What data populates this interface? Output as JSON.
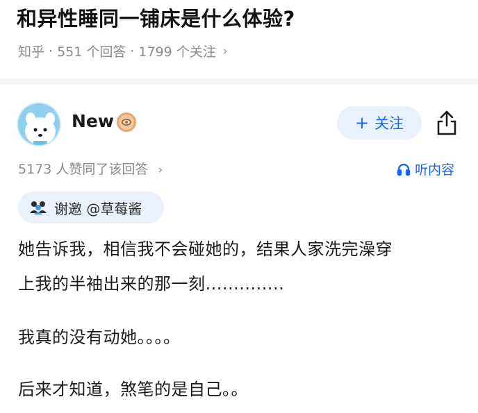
{
  "question": {
    "title": "和异性睡同一铺床是什么体验?",
    "meta": {
      "site": "知乎",
      "sep": "·",
      "answers": "551 个回答",
      "followers": "1799 个关注",
      "chevron": "›"
    }
  },
  "answer": {
    "author": {
      "name": "New",
      "avatar_icon": "cartoon-avatar-icon",
      "badge_icon": "eye-badge-icon"
    },
    "follow_button": {
      "plus": "+",
      "label": "关注"
    },
    "share_icon": "share-icon",
    "upvotes": {
      "text": "5173 人赞同了该回答",
      "chevron": "›"
    },
    "listen": {
      "icon": "headphones-icon",
      "label": "听内容"
    },
    "invite": {
      "icon": "people-icon",
      "label": "谢邀 @草莓酱"
    },
    "body": {
      "paragraph1_line1": "她告诉我，相信我不会碰她的，结果人家洗完澡穿",
      "paragraph1_line2": "上我的半袖出来的那一刻..............",
      "paragraph2": "我真的没有动她。。。。",
      "paragraph3": "后来才知道，煞笔的是自己。。"
    }
  },
  "colors": {
    "accent": "#1769f0",
    "accent_bg": "#e9f1fd",
    "meta_gray": "#8a8a8a"
  }
}
